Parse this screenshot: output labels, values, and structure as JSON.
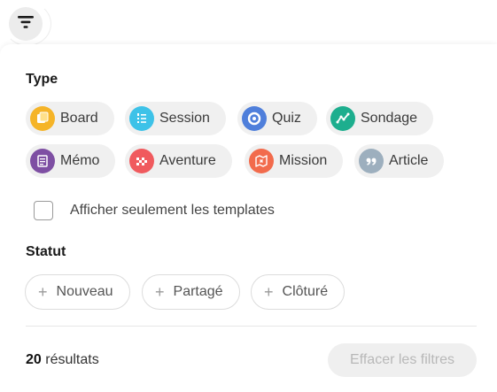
{
  "filter_toggle": {
    "icon": "filter-icon"
  },
  "type_section": {
    "title": "Type",
    "chips": [
      {
        "label": "Board",
        "icon": "board-icon",
        "color": "#F5B428"
      },
      {
        "label": "Session",
        "icon": "session-icon",
        "color": "#3DC2E8"
      },
      {
        "label": "Quiz",
        "icon": "quiz-icon",
        "color": "#4F7FDB"
      },
      {
        "label": "Sondage",
        "icon": "sondage-icon",
        "color": "#1DAE8E"
      },
      {
        "label": "Mémo",
        "icon": "memo-icon",
        "color": "#7E4FA3"
      },
      {
        "label": "Aventure",
        "icon": "aventure-icon",
        "color": "#F05A5E"
      },
      {
        "label": "Mission",
        "icon": "mission-icon",
        "color": "#F26B4C"
      },
      {
        "label": "Article",
        "icon": "article-icon",
        "color": "#9DAFBE"
      }
    ]
  },
  "templates_checkbox": {
    "label": "Afficher seulement les templates",
    "checked": false
  },
  "status_section": {
    "title": "Statut",
    "chips": [
      {
        "label": "Nouveau"
      },
      {
        "label": "Partagé"
      },
      {
        "label": "Clôturé"
      }
    ]
  },
  "footer": {
    "count": "20",
    "count_label": "résultats",
    "clear_label": "Effacer les filtres"
  }
}
